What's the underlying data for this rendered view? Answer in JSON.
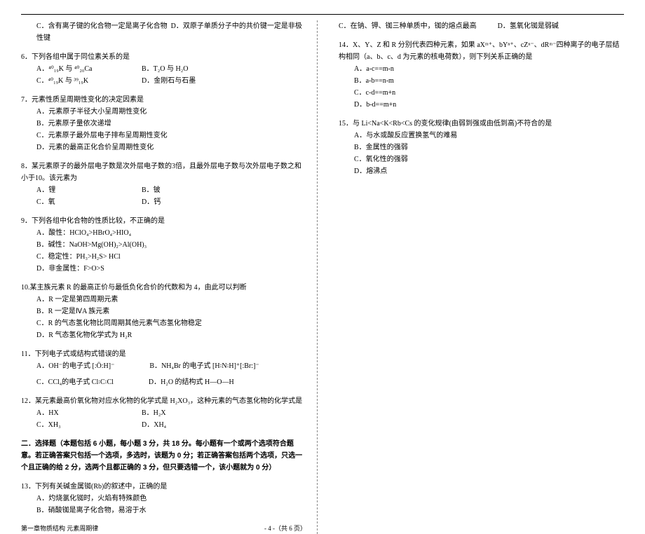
{
  "top": {
    "c": "C．含有离子键的化合物一定是离子化合物",
    "d": "D．双原子单质分子中的共价键一定是非极性键"
  },
  "q6": {
    "t": "6．下列各组中属于同位素关系的是",
    "a": "A．⁴⁰₁₉K 与 ⁴⁰₂₀Ca",
    "b": "B．T₂O 与 H₂O",
    "c": "C．⁴⁰₁₉K 与 ³⁹₁₉K",
    "d": "D．金刚石与石墨"
  },
  "q7": {
    "t": "7．元素性质呈周期性变化的决定因素是",
    "a": "A．元素原子半径大小呈周期性变化",
    "b": "B．元素原子量依次递增",
    "c": "C．元素原子最外层电子排布呈周期性变化",
    "d": "D．元素的最高正化合价呈周期性变化"
  },
  "q8": {
    "t": "8．某元素原子的最外层电子数是次外层电子数的3倍，且最外层电子数与次外层电子数之和小于10。该元素为",
    "a": "A．锂",
    "b": "B．铍",
    "c": "C．氧",
    "d": "D．钙"
  },
  "q9": {
    "t": "9．下列各组中化合物的性质比较，不正确的是",
    "a": "A．酸性：HClO₄>HBrO₄>HIO₄",
    "b": "B．碱性：NaOH>Mg(OH)₂>Al(OH)₃",
    "c": "C．稳定性：PH₃>H₂S> HCl",
    "d": "D．非金属性：F>O>S"
  },
  "q10": {
    "t": "10.某主族元素 R 的最高正价与最低负化合价的代数和为 4，由此可以判断",
    "a": "A．R 一定是第四周期元素",
    "b": "B．R 一定是ⅣA 族元素",
    "c": "C．R 的气态氢化物比同周期其他元素气态氢化物稳定",
    "d": "D．R 气态氢化物化学式为 H₂R"
  },
  "q11": {
    "t": "11．下列电子式或结构式错误的是",
    "a": "A．OH⁻的电子式",
    "b": "B．NH₄Br 的电子式",
    "c": "C．CCl₄的电子式",
    "d": "D．H₂O 的结构式 H—O—H"
  },
  "q12": {
    "t": "12．某元素最高价氧化物对应水化物的化学式是 H₂XO₃，这种元素的气态氢化物的化学式是",
    "a": "A．HX",
    "b": "B．H₂X",
    "c": "C．XH₃",
    "d": "D．XH₄"
  },
  "sec2": "二．选择题（本题包括 6 小题，每小题 3 分，共 18 分。每小题有一个或两个选项符合题意。若正确答案只包括一个选项，多选时，该题为 0 分；若正确答案包括两个选项，只选一个且正确的给 2 分，选两个且都正确的 3 分，但只要选错一个，该小题就为 0 分）",
  "q13": {
    "t": "13．下列有关碱金属铷(Rb)的叙述中，正确的是",
    "a": "A．灼烧氯化铷时，火焰有特殊颜色",
    "b": "B．硝酸铷是离子化合物，易溶于水",
    "c": "C．在钠、钾、铷三种单质中，铷的熔点最高",
    "d": "D．氢氧化铷是弱碱"
  },
  "q14": {
    "t": "14．X、Y、Z 和 R 分别代表四种元素，如果 aXᵐ⁺、bYⁿ⁺、cZⁿ⁻、dRᵐ⁻四种离子的电子层结构相同（a、b、c、d 为元素的核电荷数），则下列关系正确的是",
    "a": "A．a-c==m-n",
    "b": "B．a-b==n-m",
    "c": "C．c-d==m+n",
    "d": "D．b-d==m+n"
  },
  "q15": {
    "t": "15．与 Li<Na<K<Rb<Cs 的变化规律(由弱到强或由低到高)不符合的是",
    "a": "A．与水或酸反应置换氢气的难易",
    "b": "B．金属性的强弱",
    "c": "C．氧化性的强弱",
    "d": "D．熔沸点"
  },
  "footer": {
    "l": "第一章物质结构 元素周期律",
    "r": "- 4 -（共 6 页）"
  }
}
